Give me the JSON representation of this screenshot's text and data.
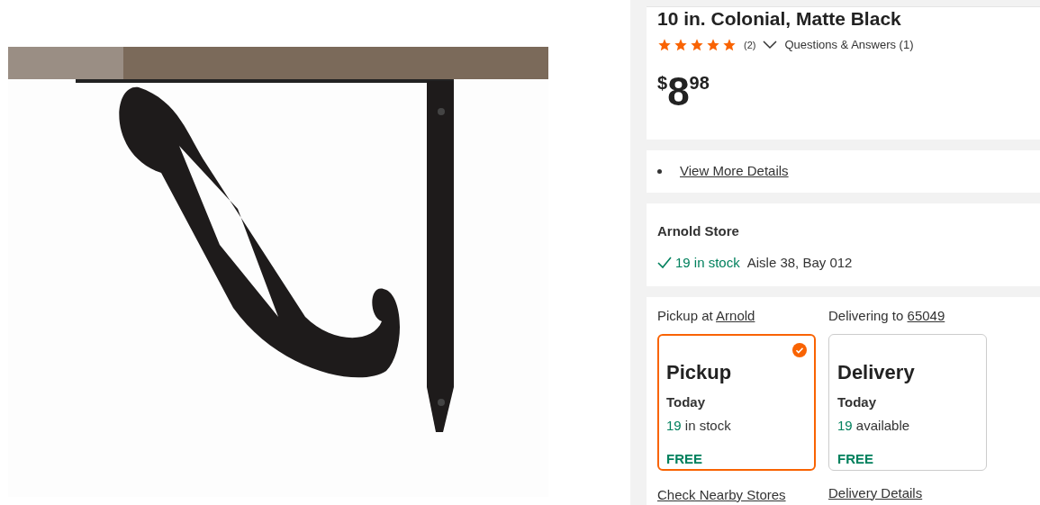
{
  "product": {
    "title": "10 in. Colonial, Matte Black",
    "stars": 5,
    "review_count": "(2)",
    "qa_link": "Questions & Answers (1)",
    "price": {
      "currency": "$",
      "dollars": "8",
      "cents": "98"
    }
  },
  "details": {
    "items": [
      "View More Details"
    ]
  },
  "store": {
    "name": "Arnold Store",
    "stock": "19 in stock",
    "location": "Aisle 38, Bay 012"
  },
  "fulfillment": {
    "options": [
      {
        "kind": "pickup",
        "header_text": "Pickup at",
        "header_link": "Arnold",
        "title": "Pickup",
        "when": "Today",
        "count": "19",
        "count_text": "in stock",
        "price": "FREE",
        "footer_link": "Check Nearby Stores",
        "selected": true
      },
      {
        "kind": "delivery",
        "header_text": "Delivering to",
        "header_link": "65049",
        "title": "Delivery",
        "when": "Today",
        "count": "19",
        "count_text": "available",
        "price": "FREE",
        "footer_link": "Delivery Details",
        "selected": false
      }
    ]
  }
}
